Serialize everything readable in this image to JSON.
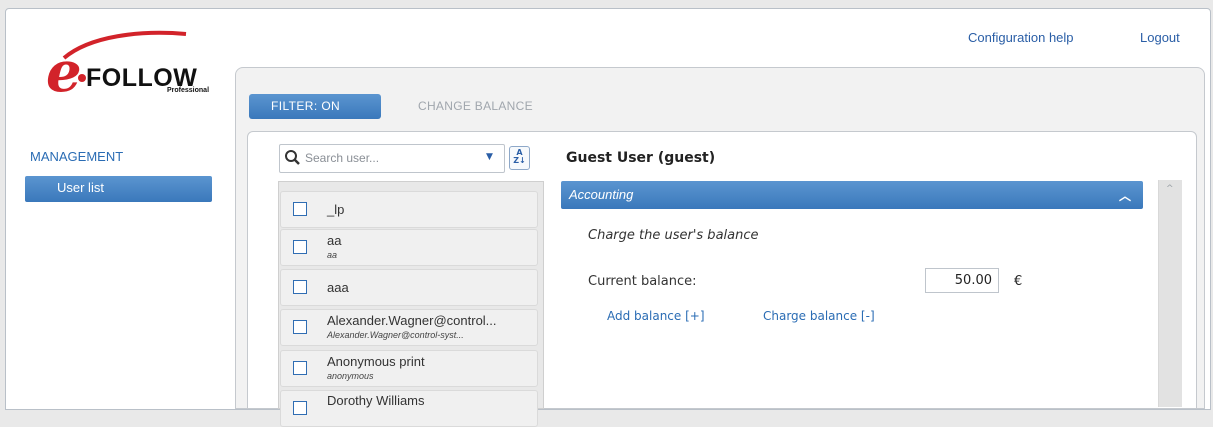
{
  "brand": {
    "logo_letter": "e",
    "logo_word": "FOLLOW",
    "logo_sub": "Professional"
  },
  "header": {
    "config_help": "Configuration help",
    "logout": "Logout"
  },
  "sidebar": {
    "section": "MANAGEMENT",
    "items": [
      {
        "label": "User list",
        "active": true
      }
    ]
  },
  "toolbar": {
    "filter_label": "FILTER: ON",
    "change_balance_label": "CHANGE BALANCE"
  },
  "search": {
    "placeholder": "Search user...",
    "sort_icon": "sort-az-icon"
  },
  "users": [
    {
      "name": "_lp",
      "sub": ""
    },
    {
      "name": "aa",
      "sub": "aa"
    },
    {
      "name": "aaa",
      "sub": ""
    },
    {
      "name": "Alexander.Wagner@control...",
      "sub": "Alexander.Wagner@control-syst..."
    },
    {
      "name": "Anonymous print",
      "sub": "anonymous"
    },
    {
      "name": "Dorothy Williams",
      "sub": ""
    }
  ],
  "detail": {
    "title": "Guest User (guest)",
    "section": "Accounting",
    "charge_title": "Charge the user's balance",
    "balance_label": "Current balance:",
    "balance_value": "50.00",
    "currency": "€",
    "add_link": "Add balance [+]",
    "charge_link": "Charge balance [-]"
  },
  "colors": {
    "accent": "#3e7fc2",
    "logo_red": "#d2232a",
    "link": "#2a6cb4"
  }
}
